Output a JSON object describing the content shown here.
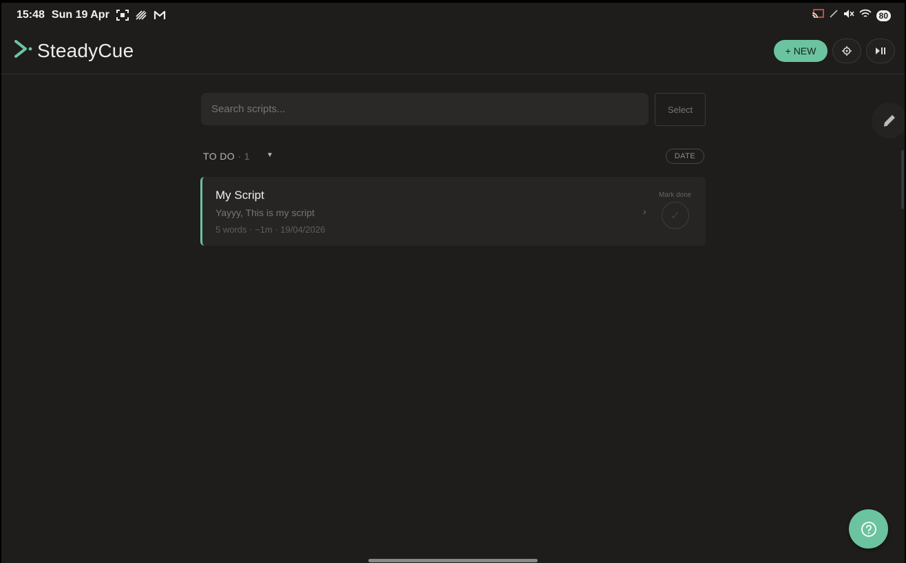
{
  "status_bar": {
    "time": "15:48",
    "date": "Sun 19 Apr",
    "battery": "80"
  },
  "header": {
    "app_name": "SteadyCue",
    "new_button": "+ NEW",
    "settings_icon": "gear-icon",
    "play_pause_icon": "play-pause-icon"
  },
  "search": {
    "placeholder": "Search scripts...",
    "value": ""
  },
  "select_button": "Select",
  "section": {
    "label": "TO DO",
    "count": " · 1",
    "sort_chip": "DATE"
  },
  "scripts": [
    {
      "title": "My Script",
      "preview": "Yayyy, This is my script",
      "meta": "5 words · ~1m · 19/04/2026",
      "mark_done_label": "Mark done"
    }
  ],
  "colors": {
    "accent": "#6bc49f",
    "background": "#1e1d1c",
    "card": "#262524"
  }
}
